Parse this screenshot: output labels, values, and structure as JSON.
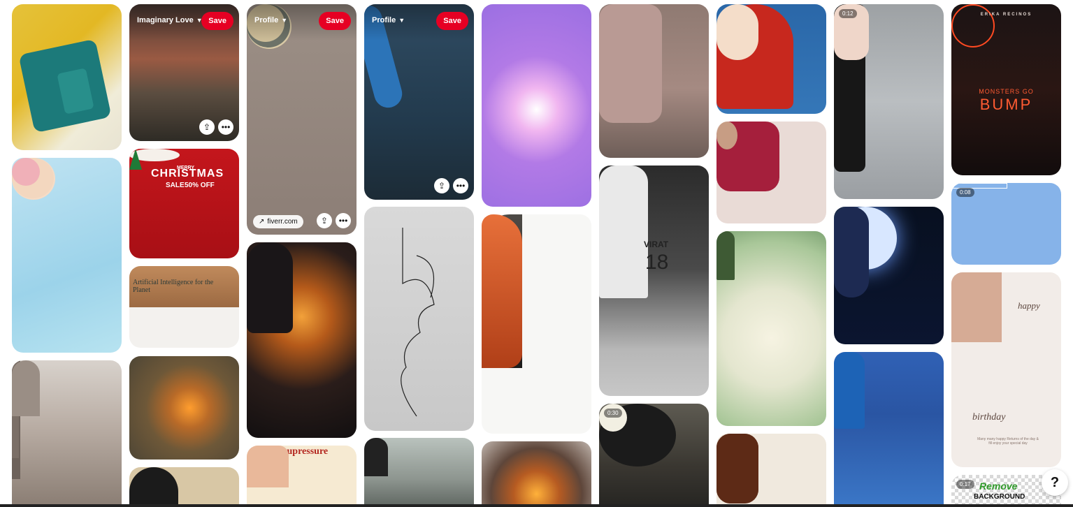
{
  "pins": [
    {
      "id": "teal-embroidered-blouse",
      "duration": ""
    },
    {
      "id": "shinchan-family-cartoon"
    },
    {
      "id": "mosque-minarets"
    },
    {
      "id": "silhouette-couple-sunset",
      "board": "Imaginary Love",
      "save": "Save",
      "hover": true
    },
    {
      "id": "christmas-sale",
      "title": "CHRISTMAS",
      "line1": "SALE",
      "pct": "50% OFF",
      "merry": "MERRY"
    },
    {
      "id": "ai-website",
      "headline": "Artificial Intelligence for the Planet"
    },
    {
      "id": "glowing-hand-shirt"
    },
    {
      "id": "haircut-portrait"
    },
    {
      "id": "paper-flowers",
      "board": "Profile",
      "save": "Save",
      "link": "fiverr.com",
      "hover": true
    },
    {
      "id": "ninja-meditation"
    },
    {
      "id": "hand-acupressure",
      "title": "Hand Acupressure Points"
    },
    {
      "id": "cricket-celebration",
      "board": "Profile",
      "save": "Save",
      "hover": true
    },
    {
      "id": "line-art-faces"
    },
    {
      "id": "motorcycle-rider"
    },
    {
      "id": "touching-hands-purple"
    },
    {
      "id": "lion-tattoo"
    },
    {
      "id": "fire-flowers"
    },
    {
      "id": "embroidered-blouse-sleeve"
    },
    {
      "id": "virat-18-back",
      "name": "VIRAT",
      "number": "18"
    },
    {
      "id": "cooking-video",
      "duration": "0:30"
    },
    {
      "id": "redhead-anime-girl"
    },
    {
      "id": "saree-model"
    },
    {
      "id": "leafy-bride"
    },
    {
      "id": "mehndi-hands"
    },
    {
      "id": "braid-tutorial",
      "duration": "0:12"
    },
    {
      "id": "krishna-moon"
    },
    {
      "id": "virat-batting"
    },
    {
      "id": "monsters-go-bump",
      "brand": "ERIKA RECINOS",
      "line1": "MONSTERS GO",
      "line2": "BUMP"
    },
    {
      "id": "progress-animation",
      "duration": "0:08"
    },
    {
      "id": "happy-birthday-card",
      "happy": "happy",
      "birthday": "birthday",
      "note": "Many many happy Returns of the day & fill enjoy your special day"
    },
    {
      "id": "remove-background",
      "duration": "0:17",
      "title": "Remove",
      "sub": "BACKGROUND"
    }
  ],
  "help": "?"
}
